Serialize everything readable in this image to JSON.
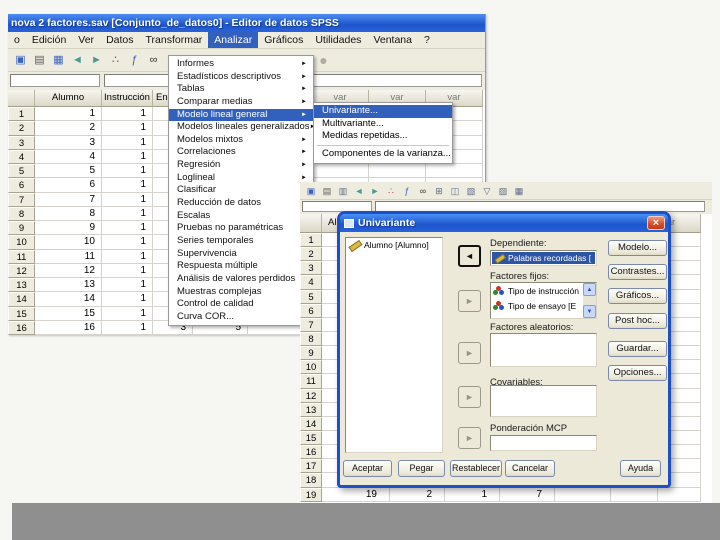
{
  "windowA": {
    "title": "nova 2 factores.sav [Conjunto_de_datos0] - Editor de datos SPSS",
    "menu": [
      {
        "label": "o"
      },
      {
        "label": "Edición"
      },
      {
        "label": "Ver"
      },
      {
        "label": "Datos"
      },
      {
        "label": "Transformar"
      },
      {
        "label": "Analizar",
        "highlighted": true
      },
      {
        "label": "Gráficos"
      },
      {
        "label": "Utilidades"
      },
      {
        "label": "Ventana"
      },
      {
        "label": "?"
      }
    ],
    "toolbar_icons": [
      {
        "name": "save-icon",
        "glyph": "▣"
      },
      {
        "name": "print-icon",
        "glyph": "▤"
      },
      {
        "name": "edit-data-icon",
        "glyph": "▦"
      },
      {
        "name": "undo-icon",
        "glyph": "◄"
      },
      {
        "name": "redo-icon",
        "glyph": "►"
      },
      {
        "name": "goto-chart-icon",
        "glyph": "∴"
      },
      {
        "name": "variables-icon",
        "glyph": "ƒ"
      },
      {
        "name": "find-icon",
        "glyph": "∞"
      }
    ],
    "toolbar_partial_icon": {
      "name": "chart-disabled-icon",
      "glyph": "●"
    },
    "headers": [
      "",
      "Alumno",
      "Instrucción",
      "Ens",
      "",
      "",
      "var",
      "var",
      "var"
    ],
    "rows": [
      {
        "n": "1",
        "a": "1",
        "i": "1",
        "c3": "",
        "c4": ""
      },
      {
        "n": "2",
        "a": "2",
        "i": "1",
        "c3": "",
        "c4": ""
      },
      {
        "n": "3",
        "a": "3",
        "i": "1",
        "c3": "",
        "c4": ""
      },
      {
        "n": "4",
        "a": "4",
        "i": "1",
        "c3": "",
        "c4": ""
      },
      {
        "n": "5",
        "a": "5",
        "i": "1",
        "c3": "",
        "c4": ""
      },
      {
        "n": "6",
        "a": "6",
        "i": "1",
        "c3": "",
        "c4": ""
      },
      {
        "n": "7",
        "a": "7",
        "i": "1",
        "c3": "",
        "c4": ""
      },
      {
        "n": "8",
        "a": "8",
        "i": "1",
        "c3": "",
        "c4": ""
      },
      {
        "n": "9",
        "a": "9",
        "i": "1",
        "c3": "",
        "c4": ""
      },
      {
        "n": "10",
        "a": "10",
        "i": "1",
        "c3": "",
        "c4": ""
      },
      {
        "n": "11",
        "a": "11",
        "i": "1",
        "c3": "",
        "c4": ""
      },
      {
        "n": "12",
        "a": "12",
        "i": "1",
        "c3": "",
        "c4": ""
      },
      {
        "n": "13",
        "a": "13",
        "i": "1",
        "c3": "",
        "c4": ""
      },
      {
        "n": "14",
        "a": "14",
        "i": "1",
        "c3": "",
        "c4": ""
      },
      {
        "n": "15",
        "a": "15",
        "i": "1",
        "c3": "",
        "c4": ""
      },
      {
        "n": "16",
        "a": "16",
        "i": "1",
        "c3": "3",
        "c4": "5"
      }
    ]
  },
  "menu": {
    "items": [
      {
        "label": "Informes",
        "arrow": "►"
      },
      {
        "label": "Estadísticos descriptivos",
        "arrow": "►"
      },
      {
        "label": "Tablas",
        "arrow": "►"
      },
      {
        "label": "Comparar medias",
        "arrow": "►"
      },
      {
        "label": "Modelo lineal general",
        "arrow": "►",
        "highlighted": true
      },
      {
        "label": "Modelos lineales generalizados",
        "arrow": "►"
      },
      {
        "label": "Modelos mixtos",
        "arrow": "►"
      },
      {
        "label": "Correlaciones",
        "arrow": "►"
      },
      {
        "label": "Regresión",
        "arrow": "►"
      },
      {
        "label": "Loglineal",
        "arrow": "►"
      },
      {
        "label": "Clasificar",
        "arrow": "►"
      },
      {
        "label": "Reducción de datos",
        "arrow": "►"
      },
      {
        "label": "Escalas",
        "arrow": "►"
      },
      {
        "label": "Pruebas no paramétricas",
        "arrow": "►"
      },
      {
        "label": "Series temporales",
        "arrow": "►"
      },
      {
        "label": "Supervivencia",
        "arrow": "►"
      },
      {
        "label": "Respuesta múltiple",
        "arrow": "►"
      },
      {
        "label": "Análisis de valores perdidos",
        "arrow": ""
      },
      {
        "label": "Muestras complejas",
        "arrow": "►"
      },
      {
        "label": "Control de calidad",
        "arrow": "►"
      },
      {
        "label": "Curva COR...",
        "arrow": ""
      }
    ]
  },
  "submenu": {
    "items": [
      {
        "label": "Univariante...",
        "highlighted": true
      },
      {
        "label": "Multivariante..."
      },
      {
        "label": "Medidas repetidas..."
      }
    ],
    "items_after_separator": [
      {
        "label": "Componentes de la varianza..."
      }
    ]
  },
  "windowB": {
    "toolbar_icons": [
      {
        "name": "save-icon",
        "glyph": "▣"
      },
      {
        "name": "print-icon",
        "glyph": "▤"
      },
      {
        "name": "recall-dialog-icon",
        "glyph": "▥"
      },
      {
        "name": "undo-icon",
        "glyph": "◄"
      },
      {
        "name": "redo-icon",
        "glyph": "►"
      },
      {
        "name": "goto-chart-icon",
        "glyph": "∴"
      },
      {
        "name": "variables-icon",
        "glyph": "ƒ"
      },
      {
        "name": "find-icon",
        "glyph": "∞"
      },
      {
        "name": "insert-case-icon",
        "glyph": "⊞"
      },
      {
        "name": "insert-variable-icon",
        "glyph": "◫"
      },
      {
        "name": "split-file-icon",
        "glyph": "▧"
      },
      {
        "name": "weight-cases-icon",
        "glyph": "▽"
      },
      {
        "name": "value-labels-icon",
        "glyph": "▨"
      },
      {
        "name": "use-sets-icon",
        "glyph": "▦"
      }
    ],
    "headers": [
      "",
      "Alumno",
      "",
      "",
      "",
      "",
      "",
      "var"
    ],
    "rows": [
      {
        "n": "1",
        "c1": "",
        "c2": "",
        "c3": "",
        "c4": ""
      },
      {
        "n": "2",
        "c1": "",
        "c2": "",
        "c3": "",
        "c4": ""
      },
      {
        "n": "3",
        "c1": "",
        "c2": "",
        "c3": "",
        "c4": ""
      },
      {
        "n": "4",
        "c1": "",
        "c2": "",
        "c3": "",
        "c4": ""
      },
      {
        "n": "5",
        "c1": "",
        "c2": "",
        "c3": "",
        "c4": ""
      },
      {
        "n": "6",
        "c1": "",
        "c2": "",
        "c3": "",
        "c4": ""
      },
      {
        "n": "7",
        "c1": "",
        "c2": "",
        "c3": "",
        "c4": ""
      },
      {
        "n": "8",
        "c1": "",
        "c2": "",
        "c3": "",
        "c4": ""
      },
      {
        "n": "9",
        "c1": "",
        "c2": "",
        "c3": "",
        "c4": ""
      },
      {
        "n": "10",
        "c1": "",
        "c2": "",
        "c3": "",
        "c4": ""
      },
      {
        "n": "11",
        "c1": "",
        "c2": "",
        "c3": "",
        "c4": ""
      },
      {
        "n": "12",
        "c1": "",
        "c2": "",
        "c3": "",
        "c4": ""
      },
      {
        "n": "13",
        "c1": "",
        "c2": "",
        "c3": "",
        "c4": ""
      },
      {
        "n": "14",
        "c1": "",
        "c2": "",
        "c3": "",
        "c4": ""
      },
      {
        "n": "15",
        "c1": "",
        "c2": "",
        "c3": "",
        "c4": ""
      },
      {
        "n": "16",
        "c1": "",
        "c2": "",
        "c3": "",
        "c4": ""
      },
      {
        "n": "17",
        "c1": "",
        "c2": "",
        "c3": "",
        "c4": ""
      },
      {
        "n": "18",
        "c1": "",
        "c2": "",
        "c3": "",
        "c4": ""
      },
      {
        "n": "19",
        "c1": "19",
        "c2": "2",
        "c3": "1",
        "c4": "7"
      }
    ]
  },
  "dialog": {
    "title": "Univariante",
    "close_glyph": "×",
    "source_items": [
      {
        "label": "Alumno [Alumno]"
      }
    ],
    "dependent_label": "Dependiente:",
    "dependent_value": "Palabras recordadas [",
    "fixed_label": "Factores fijos:",
    "fixed_items": [
      {
        "label": "Tipo de instrucción"
      },
      {
        "label": "Tipo de ensayo [E"
      }
    ],
    "random_label": "Factores aleatorios:",
    "covariates_label": "Covariables:",
    "wls_label": "Ponderación MCP",
    "arrow_left": "◄",
    "arrow_right": "►",
    "scroll_up": "▲",
    "scroll_down": "▼",
    "right_buttons": [
      {
        "label": "Modelo..."
      },
      {
        "label": "Contrastes..."
      },
      {
        "label": "Gráficos..."
      },
      {
        "label": "Post hoc..."
      },
      {
        "label": "Guardar..."
      },
      {
        "label": "Opciones..."
      }
    ],
    "bottom_buttons": [
      {
        "label": "Aceptar"
      },
      {
        "label": "Pegar"
      },
      {
        "label": "Restablecer"
      },
      {
        "label": "Cancelar"
      },
      {
        "label": "Ayuda"
      }
    ],
    "colors": {
      "titlebar": "#2a62d8",
      "border": "#1c50c8",
      "selection": "#2c55a5",
      "highlight": "#3160bd"
    }
  }
}
